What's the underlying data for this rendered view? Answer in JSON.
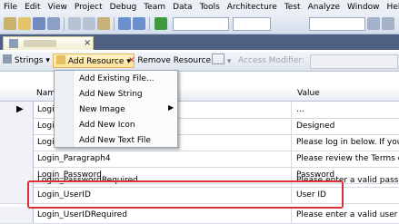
{
  "menubar": [
    "File",
    "Edit",
    "View",
    "Project",
    "Debug",
    "Team",
    "Data",
    "Tools",
    "Architecture",
    "Test",
    "Analyze",
    "Window",
    "Help"
  ],
  "resource_toolbar": {
    "strings_label": "Strings",
    "add_resource_label": "Add Resource",
    "remove_resource_label": "Remove Resource",
    "access_modifier_label": "Access Modifier:"
  },
  "add_resource_menu": {
    "items": [
      "Add Existing File...",
      "Add New String",
      "New Image",
      "Add New Icon",
      "Add New Text File"
    ]
  },
  "grid": {
    "columns": {
      "name": "Nam",
      "value": "Value"
    },
    "rows": [
      {
        "name": "Login",
        "value": "..."
      },
      {
        "name": "Login",
        "value": "Designed"
      },
      {
        "name": "Login",
        "value": "Please log in below. If you w"
      },
      {
        "name": "Login_Paragraph4",
        "value": "Please review the Terms of Us"
      },
      {
        "name": "Login_Password",
        "value": "Password"
      },
      {
        "name": "Login_PasswordRequired",
        "value": "Please enter a valid passwor"
      },
      {
        "name": "Login_UserID",
        "value": "User ID"
      },
      {
        "name": "Login_UserIDRequired",
        "value": "Please enter a valid user ID"
      }
    ]
  },
  "colors": {
    "annotation": "#d8303a",
    "tab_row": "#4d6082",
    "highlight": "#fde29a"
  }
}
